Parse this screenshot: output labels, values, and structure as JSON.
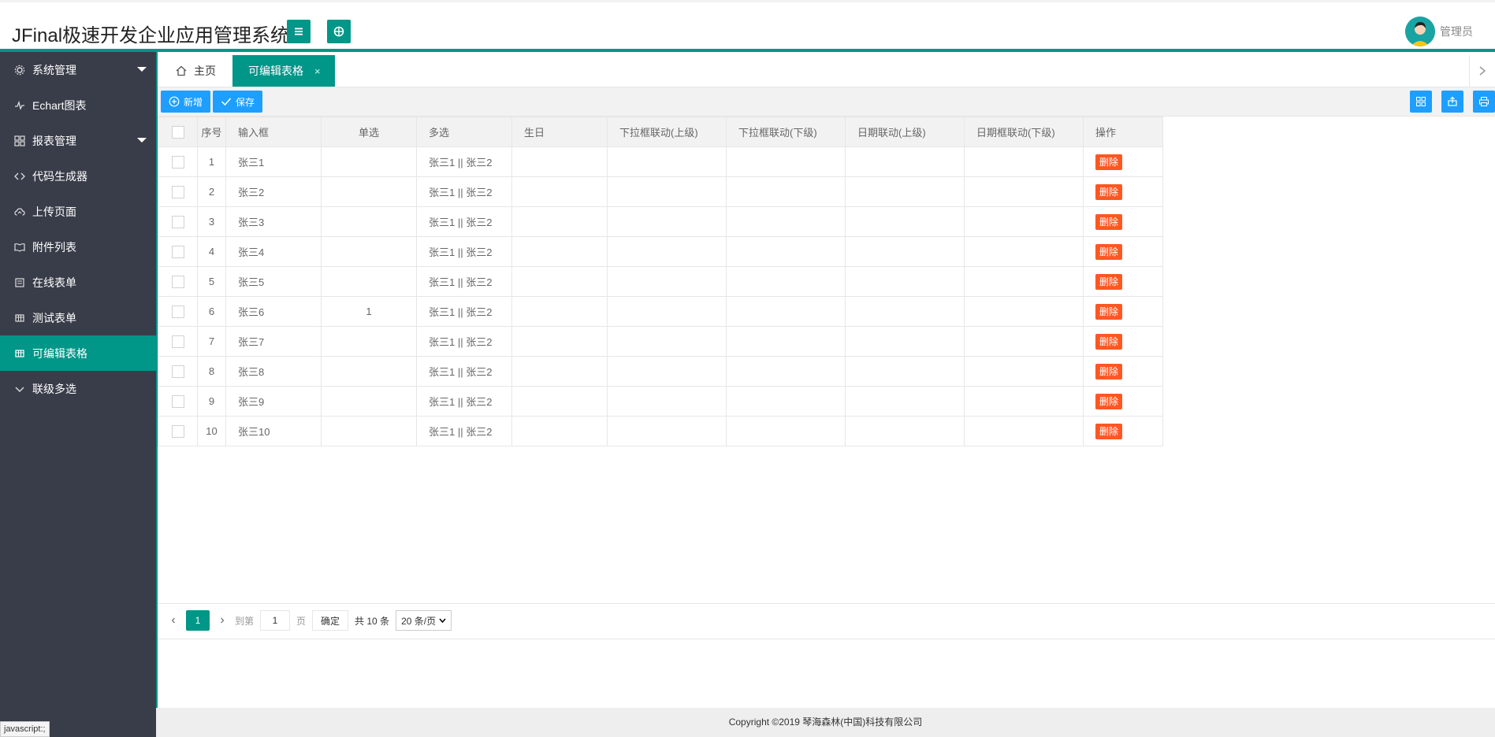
{
  "app": {
    "title": "JFinal极速开发企业应用管理系统",
    "user": "管理员"
  },
  "sidebar": {
    "items": [
      {
        "label": "系统管理",
        "icon": "gear-icon",
        "has_caret": true
      },
      {
        "label": "Echart图表",
        "icon": "pulse-icon"
      },
      {
        "label": "报表管理",
        "icon": "app-grid-icon",
        "has_caret": true
      },
      {
        "label": "代码生成器",
        "icon": "code-icon"
      },
      {
        "label": "上传页面",
        "icon": "upload-cloud-icon"
      },
      {
        "label": "附件列表",
        "icon": "book-icon"
      },
      {
        "label": "在线表单",
        "icon": "form-icon"
      },
      {
        "label": "测试表单",
        "icon": "table-icon"
      },
      {
        "label": "可编辑表格",
        "icon": "table-icon",
        "active": true
      },
      {
        "label": "联级多选",
        "icon": "chevron-down-icon"
      }
    ]
  },
  "tabs": {
    "home": "主页",
    "active": "可编辑表格",
    "close": "×"
  },
  "toolbar": {
    "add": "新增",
    "save": "保存"
  },
  "table": {
    "headers": [
      "序号",
      "输入框",
      "单选",
      "多选",
      "生日",
      "下拉框联动(上级)",
      "下拉框联动(下级)",
      "日期联动(上级)",
      "日期框联动(下级)",
      "操作"
    ],
    "delete_label": "删除",
    "rows": [
      {
        "no": "1",
        "input": "张三1",
        "radio": "",
        "multi": "张三1 || 张三2"
      },
      {
        "no": "2",
        "input": "张三2",
        "radio": "",
        "multi": "张三1 || 张三2"
      },
      {
        "no": "3",
        "input": "张三3",
        "radio": "",
        "multi": "张三1 || 张三2"
      },
      {
        "no": "4",
        "input": "张三4",
        "radio": "",
        "multi": "张三1 || 张三2"
      },
      {
        "no": "5",
        "input": "张三5",
        "radio": "",
        "multi": "张三1 || 张三2"
      },
      {
        "no": "6",
        "input": "张三6",
        "radio": "1",
        "multi": "张三1 || 张三2"
      },
      {
        "no": "7",
        "input": "张三7",
        "radio": "",
        "multi": "张三1 || 张三2"
      },
      {
        "no": "8",
        "input": "张三8",
        "radio": "",
        "multi": "张三1 || 张三2"
      },
      {
        "no": "9",
        "input": "张三9",
        "radio": "",
        "multi": "张三1 || 张三2"
      },
      {
        "no": "10",
        "input": "张三10",
        "radio": "",
        "multi": "张三1 || 张三2"
      }
    ]
  },
  "pager": {
    "current": "1",
    "goto": "到第",
    "page_value": "1",
    "page_unit": "页",
    "confirm": "确定",
    "total": "共 10 条",
    "page_size": "20 条/页"
  },
  "footer": {
    "copyright": "Copyright ©2019 琴海森林(中国)科技有限公司"
  },
  "status_bar": {
    "text": "javascript:;"
  },
  "colors": {
    "accent": "#009688",
    "sidebar_bg": "#393d49",
    "button_blue": "#1e9fff",
    "danger": "#ff5722"
  }
}
